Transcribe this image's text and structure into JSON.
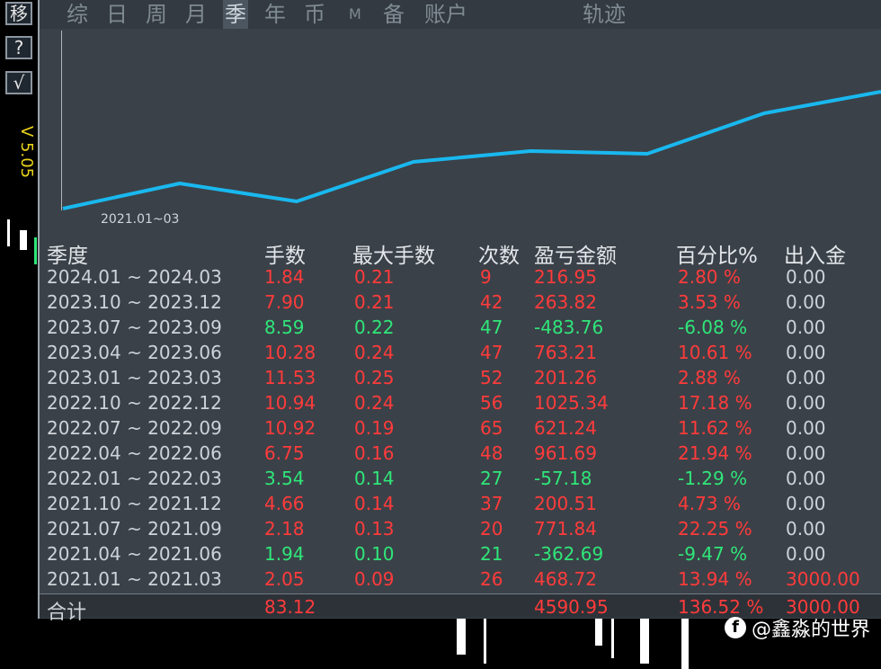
{
  "toolbar": {
    "move_label": "移",
    "help_label": "?",
    "check_label": "√",
    "version": "V 5.05"
  },
  "tabs": [
    "综",
    "日",
    "周",
    "月",
    "季",
    "年",
    "币",
    "M",
    "备",
    "账户"
  ],
  "active_tab": "季",
  "chart_title": "轨迹",
  "chart_start_label": "2021.01~03",
  "colors": {
    "profit": "#ff3b3b",
    "loss": "#2fe67a",
    "neutral": "#cdd3d8",
    "line": "#19b8ef"
  },
  "table": {
    "headers": [
      "季度",
      "手数",
      "最大手数",
      "次数",
      "盈亏金额",
      "百分比%",
      "出入金"
    ],
    "rows": [
      {
        "period": "2024.01 ~ 2024.03",
        "lots": "1.84",
        "max_lots": "0.21",
        "count": "9",
        "pnl": "216.95",
        "pct": "2.80 %",
        "flow": "0.00",
        "dir": "up"
      },
      {
        "period": "2023.10 ~ 2023.12",
        "lots": "7.90",
        "max_lots": "0.21",
        "count": "42",
        "pnl": "263.82",
        "pct": "3.53 %",
        "flow": "0.00",
        "dir": "up"
      },
      {
        "period": "2023.07 ~ 2023.09",
        "lots": "8.59",
        "max_lots": "0.22",
        "count": "47",
        "pnl": "-483.76",
        "pct": "-6.08 %",
        "flow": "0.00",
        "dir": "down"
      },
      {
        "period": "2023.04 ~ 2023.06",
        "lots": "10.28",
        "max_lots": "0.24",
        "count": "47",
        "pnl": "763.21",
        "pct": "10.61 %",
        "flow": "0.00",
        "dir": "up"
      },
      {
        "period": "2023.01 ~ 2023.03",
        "lots": "11.53",
        "max_lots": "0.25",
        "count": "52",
        "pnl": "201.26",
        "pct": "2.88 %",
        "flow": "0.00",
        "dir": "up"
      },
      {
        "period": "2022.10 ~ 2022.12",
        "lots": "10.94",
        "max_lots": "0.24",
        "count": "56",
        "pnl": "1025.34",
        "pct": "17.18 %",
        "flow": "0.00",
        "dir": "up"
      },
      {
        "period": "2022.07 ~ 2022.09",
        "lots": "10.92",
        "max_lots": "0.19",
        "count": "65",
        "pnl": "621.24",
        "pct": "11.62 %",
        "flow": "0.00",
        "dir": "up"
      },
      {
        "period": "2022.04 ~ 2022.06",
        "lots": "6.75",
        "max_lots": "0.16",
        "count": "48",
        "pnl": "961.69",
        "pct": "21.94 %",
        "flow": "0.00",
        "dir": "up"
      },
      {
        "period": "2022.01 ~ 2022.03",
        "lots": "3.54",
        "max_lots": "0.14",
        "count": "27",
        "pnl": "-57.18",
        "pct": "-1.29 %",
        "flow": "0.00",
        "dir": "down"
      },
      {
        "period": "2021.10 ~ 2021.12",
        "lots": "4.66",
        "max_lots": "0.14",
        "count": "37",
        "pnl": "200.51",
        "pct": "4.73 %",
        "flow": "0.00",
        "dir": "up"
      },
      {
        "period": "2021.07 ~ 2021.09",
        "lots": "2.18",
        "max_lots": "0.13",
        "count": "20",
        "pnl": "771.84",
        "pct": "22.25 %",
        "flow": "0.00",
        "dir": "up"
      },
      {
        "period": "2021.04 ~ 2021.06",
        "lots": "1.94",
        "max_lots": "0.10",
        "count": "21",
        "pnl": "-362.69",
        "pct": "-9.47 %",
        "flow": "0.00",
        "dir": "down"
      },
      {
        "period": "2021.01 ~ 2021.03",
        "lots": "2.05",
        "max_lots": "0.09",
        "count": "26",
        "pnl": "468.72",
        "pct": "13.94 %",
        "flow": "3000.00",
        "dir": "up"
      }
    ],
    "total": {
      "label": "合计",
      "lots": "83.12",
      "pnl": "4590.95",
      "pct": "136.52 %",
      "flow": "3000.00"
    }
  },
  "watermark": "@鑫淼的世界"
}
